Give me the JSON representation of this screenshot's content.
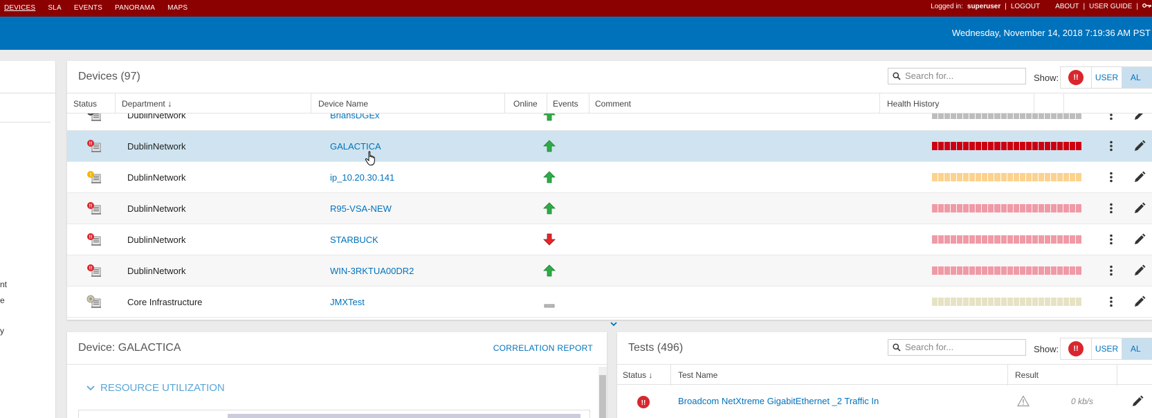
{
  "nav": {
    "items": [
      "DEVICES",
      "SLA",
      "EVENTS",
      "PANORAMA",
      "MAPS"
    ],
    "logged_in_label": "Logged in:",
    "user": "superuser",
    "logout": "LOGOUT",
    "about": "ABOUT",
    "user_guide": "USER GUIDE",
    "sep": "|"
  },
  "datetime": "Wednesday, November 14, 2018 7:19:36 AM PST",
  "left_fragments": [
    "nt",
    "e",
    "y"
  ],
  "devices": {
    "title": "Devices (97)",
    "search_placeholder": "Search for...",
    "show_label": "Show:",
    "toggle": {
      "alert": "!!",
      "user": "USER",
      "all": "AL"
    },
    "columns": [
      "Status",
      "Department",
      "Device Name",
      "Online",
      "Events",
      "Comment",
      "Health History"
    ],
    "sort_arrow": "↓",
    "rows": [
      {
        "status": "unknown",
        "department": "DublinNetwork",
        "name": "BriansDGEx",
        "online": "up",
        "health": "gray"
      },
      {
        "status": "critical",
        "department": "DublinNetwork",
        "name": "GALACTICA",
        "online": "up",
        "health": "red",
        "selected": true
      },
      {
        "status": "warning",
        "department": "DublinNetwork",
        "name": "ip_10.20.30.141",
        "online": "up",
        "health": "orange"
      },
      {
        "status": "critical",
        "department": "DublinNetwork",
        "name": "R95-VSA-NEW",
        "online": "up",
        "health": "pink"
      },
      {
        "status": "critical",
        "department": "DublinNetwork",
        "name": "STARBUCK",
        "online": "down",
        "health": "pink"
      },
      {
        "status": "critical",
        "department": "DublinNetwork",
        "name": "WIN-3RKTUA00DR2",
        "online": "up",
        "health": "pink"
      },
      {
        "status": "other",
        "department": "Core Infrastructure",
        "name": "JMXTest",
        "online": "none",
        "health": "beige"
      }
    ]
  },
  "detail": {
    "title": "Device: GALACTICA",
    "correlation": "CORRELATION REPORT",
    "section": "RESOURCE UTILIZATION"
  },
  "tests": {
    "title": "Tests (496)",
    "search_placeholder": "Search for...",
    "show_label": "Show:",
    "toggle": {
      "alert": "!!",
      "user": "USER",
      "all": "AL"
    },
    "columns": [
      "Status",
      "Test Name",
      "Result"
    ],
    "sort_arrow": "↓",
    "row": {
      "name": "Broadcom NetXtreme GigabitEthernet _2 Traffic In",
      "value": "0 kb/s"
    }
  },
  "colors": {
    "nav_bg": "#8b0000",
    "header_bg": "#0072bc",
    "link": "#0072bc",
    "critical": "#d9262e",
    "health_red": "#cc0011",
    "health_pink": "#ef9aa6",
    "health_orange": "#fbd28e",
    "health_gray": "#bdbdbd",
    "health_beige": "#e6e2c4"
  }
}
